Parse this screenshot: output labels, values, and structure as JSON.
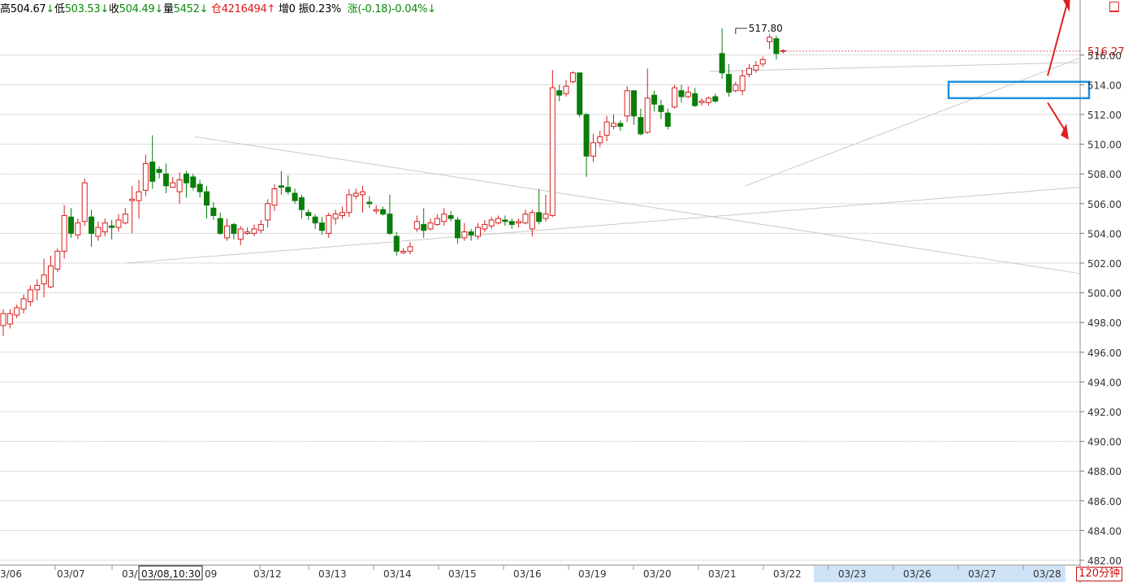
{
  "header": {
    "high_label": "高",
    "high_value": "504.67",
    "high_arrow": "↓",
    "low_label": "低",
    "low_value": "503.53",
    "low_arrow": "↓",
    "close_label": "收",
    "close_value": "504.49",
    "close_arrow": "↓",
    "volume_label": "量",
    "volume_value": "5452",
    "volume_arrow": "↓",
    "oi_label": "仓",
    "oi_value": "4216494",
    "oi_arrow": "↑",
    "oi_change_label": "增",
    "oi_change_value": "0",
    "amplitude_label": "振",
    "amplitude_value": "0.23%",
    "change_label": "涨",
    "change_value": "(-0.18)-0.04%",
    "change_arrow": "↓"
  },
  "cursor_label": "03/08,10:30",
  "period_label": "120分钟",
  "price_tag": "516.27",
  "peak_label": "517.80",
  "colors": {
    "up": "#d81e1e",
    "down": "#0a7d0a",
    "grid": "#b9b9b9",
    "trend": "#c9c9c9",
    "highlight_box": "#1f8fe0",
    "arrow": "#e02020",
    "date_highlight": "#cfe3f7"
  },
  "chart_data": {
    "type": "candlestick",
    "interval": "120分钟",
    "ylim": [
      481,
      521
    ],
    "y_ticks": [
      "482.00",
      "484.00",
      "486.00",
      "488.00",
      "490.00",
      "492.00",
      "494.00",
      "496.00",
      "498.00",
      "500.00",
      "502.00",
      "504.00",
      "506.00",
      "508.00",
      "510.00",
      "512.00",
      "514.00",
      "516.00"
    ],
    "x_ticks": [
      "3/06",
      "03/07",
      "03/",
      "09",
      "03/12",
      "03/13",
      "03/14",
      "03/15",
      "03/16",
      "03/19",
      "03/20",
      "03/21",
      "03/22",
      "03/23",
      "03/26",
      "03/27",
      "03/28"
    ],
    "last_price": 516.27,
    "marked_high": 517.8,
    "candles": [
      [
        497.8,
        498.6,
        497.1,
        498.9
      ],
      [
        497.9,
        498.6,
        497.6,
        498.9
      ],
      [
        498.5,
        499.0,
        498.3,
        499.2
      ],
      [
        498.9,
        499.6,
        498.6,
        499.9
      ],
      [
        499.4,
        500.2,
        499.1,
        500.5
      ],
      [
        500.2,
        500.5,
        499.5,
        500.9
      ],
      [
        500.6,
        501.2,
        499.7,
        502.3
      ],
      [
        500.4,
        501.8,
        500.3,
        502.5
      ],
      [
        501.6,
        502.8,
        501.4,
        503.0
      ],
      [
        502.8,
        505.2,
        502.3,
        505.9
      ],
      [
        505.1,
        504.0,
        503.7,
        505.7
      ],
      [
        503.9,
        504.7,
        503.6,
        505.0
      ],
      [
        504.8,
        507.4,
        504.5,
        507.7
      ],
      [
        505.1,
        504.0,
        503.1,
        505.6
      ],
      [
        503.8,
        504.4,
        503.5,
        504.8
      ],
      [
        504.1,
        504.7,
        503.8,
        505.0
      ],
      [
        504.5,
        504.4,
        503.6,
        504.9
      ],
      [
        504.4,
        504.9,
        504.1,
        505.3
      ],
      [
        504.7,
        505.3,
        504.6,
        505.7
      ],
      [
        506.2,
        506.3,
        504.0,
        507.2
      ],
      [
        506.2,
        506.8,
        505.0,
        507.6
      ],
      [
        506.9,
        508.7,
        506.5,
        509.3
      ],
      [
        508.8,
        507.5,
        507.0,
        510.6
      ],
      [
        508.3,
        508.1,
        507.7,
        508.5
      ],
      [
        508.0,
        507.2,
        506.7,
        508.7
      ],
      [
        507.1,
        507.4,
        507.1,
        507.8
      ],
      [
        506.8,
        507.6,
        506.0,
        508.1
      ],
      [
        508.0,
        507.4,
        506.4,
        508.2
      ],
      [
        507.8,
        507.1,
        506.9,
        508.0
      ],
      [
        507.3,
        506.8,
        506.4,
        507.6
      ],
      [
        506.8,
        505.9,
        505.0,
        507.2
      ],
      [
        505.7,
        505.2,
        504.9,
        506.1
      ],
      [
        505.0,
        504.0,
        503.9,
        505.4
      ],
      [
        503.7,
        504.5,
        503.5,
        505.0
      ],
      [
        504.6,
        504.0,
        503.6,
        504.7
      ],
      [
        503.6,
        504.3,
        503.2,
        504.5
      ],
      [
        504.0,
        504.1,
        503.9,
        504.4
      ],
      [
        504.0,
        504.3,
        503.8,
        504.6
      ],
      [
        504.2,
        504.6,
        504.0,
        504.9
      ],
      [
        504.9,
        506.0,
        504.4,
        506.3
      ],
      [
        505.9,
        507.0,
        505.5,
        507.3
      ],
      [
        507.2,
        507.1,
        506.6,
        508.2
      ],
      [
        507.1,
        506.8,
        506.6,
        507.9
      ],
      [
        506.7,
        506.2,
        506.0,
        507.0
      ],
      [
        506.4,
        505.6,
        505.0,
        506.6
      ],
      [
        505.4,
        505.2,
        504.9,
        505.6
      ],
      [
        505.1,
        504.7,
        504.3,
        505.3
      ],
      [
        504.7,
        504.2,
        503.9,
        505.1
      ],
      [
        504.0,
        505.2,
        503.7,
        505.4
      ],
      [
        505.0,
        505.3,
        504.6,
        505.6
      ],
      [
        505.2,
        505.4,
        505.0,
        505.8
      ],
      [
        505.4,
        506.6,
        505.1,
        507.0
      ],
      [
        506.5,
        506.7,
        506.3,
        507.0
      ],
      [
        506.6,
        506.8,
        505.4,
        507.2
      ],
      [
        506.1,
        506.0,
        505.7,
        506.5
      ],
      [
        505.5,
        505.6,
        505.3,
        505.9
      ],
      [
        505.6,
        505.3,
        505.2,
        505.8
      ],
      [
        505.3,
        504.0,
        503.9,
        506.6
      ],
      [
        503.8,
        502.8,
        502.5,
        504.1
      ],
      [
        502.7,
        502.8,
        502.6,
        503.0
      ],
      [
        502.8,
        503.1,
        502.6,
        503.4
      ],
      [
        504.3,
        504.8,
        504.1,
        505.2
      ],
      [
        504.6,
        504.2,
        503.7,
        505.7
      ],
      [
        504.3,
        504.7,
        504.2,
        505.0
      ],
      [
        504.6,
        505.0,
        504.5,
        505.3
      ],
      [
        504.8,
        505.3,
        504.5,
        505.7
      ],
      [
        505.2,
        505.0,
        504.8,
        505.5
      ],
      [
        504.9,
        503.7,
        503.3,
        505.1
      ],
      [
        503.7,
        504.1,
        503.5,
        504.7
      ],
      [
        504.1,
        503.9,
        503.5,
        504.3
      ],
      [
        503.8,
        504.4,
        503.6,
        504.7
      ],
      [
        504.3,
        504.6,
        504.1,
        504.9
      ],
      [
        504.5,
        504.9,
        504.3,
        505.1
      ],
      [
        504.7,
        505.0,
        504.6,
        505.2
      ],
      [
        504.9,
        504.8,
        504.5,
        505.2
      ],
      [
        504.8,
        504.6,
        504.3,
        505.0
      ],
      [
        504.7,
        504.8,
        504.4,
        505.0
      ],
      [
        504.7,
        505.3,
        504.6,
        505.6
      ],
      [
        504.3,
        505.4,
        503.8,
        505.6
      ],
      [
        505.4,
        504.8,
        504.6,
        507.0
      ],
      [
        505.0,
        505.3,
        504.8,
        506.6
      ],
      [
        505.2,
        513.8,
        505.1,
        515.0
      ],
      [
        513.6,
        513.3,
        512.9,
        514.0
      ],
      [
        513.4,
        513.9,
        513.2,
        514.3
      ],
      [
        514.2,
        514.8,
        514.1,
        514.9
      ],
      [
        514.8,
        512.0,
        511.8,
        514.8
      ],
      [
        512.0,
        509.2,
        507.8,
        512.1
      ],
      [
        509.2,
        510.1,
        508.8,
        510.7
      ],
      [
        510.1,
        510.5,
        509.8,
        510.9
      ],
      [
        510.6,
        511.5,
        510.2,
        511.9
      ],
      [
        511.2,
        511.4,
        511.0,
        512.0
      ],
      [
        511.4,
        511.2,
        510.9,
        511.6
      ],
      [
        511.9,
        513.6,
        511.5,
        513.9
      ],
      [
        513.6,
        511.9,
        511.3,
        513.6
      ],
      [
        511.8,
        510.7,
        510.6,
        512.4
      ],
      [
        510.8,
        513.1,
        510.7,
        515.1
      ],
      [
        513.3,
        512.7,
        512.2,
        513.6
      ],
      [
        512.6,
        512.2,
        511.7,
        513.0
      ],
      [
        512.1,
        511.2,
        511.0,
        512.4
      ],
      [
        512.5,
        513.8,
        512.4,
        514.0
      ],
      [
        513.6,
        513.2,
        512.8,
        514.0
      ],
      [
        513.2,
        513.5,
        513.1,
        513.9
      ],
      [
        513.4,
        512.6,
        512.5,
        513.8
      ],
      [
        512.8,
        512.9,
        512.6,
        513.1
      ],
      [
        512.8,
        513.1,
        512.6,
        513.2
      ],
      [
        513.2,
        512.9,
        512.8,
        513.4
      ],
      [
        516.1,
        514.8,
        514.4,
        517.8
      ],
      [
        514.7,
        513.5,
        513.2,
        515.4
      ],
      [
        513.6,
        514.0,
        513.5,
        514.2
      ],
      [
        513.6,
        514.6,
        513.3,
        515.0
      ],
      [
        514.7,
        515.1,
        514.5,
        515.4
      ],
      [
        515.0,
        515.3,
        514.8,
        515.6
      ],
      [
        515.4,
        515.7,
        515.2,
        515.9
      ],
      [
        516.9,
        517.2,
        516.4,
        517.4
      ],
      [
        517.1,
        516.1,
        515.7,
        517.3
      ],
      [
        516.3,
        516.3,
        516.1,
        516.4
      ]
    ]
  }
}
